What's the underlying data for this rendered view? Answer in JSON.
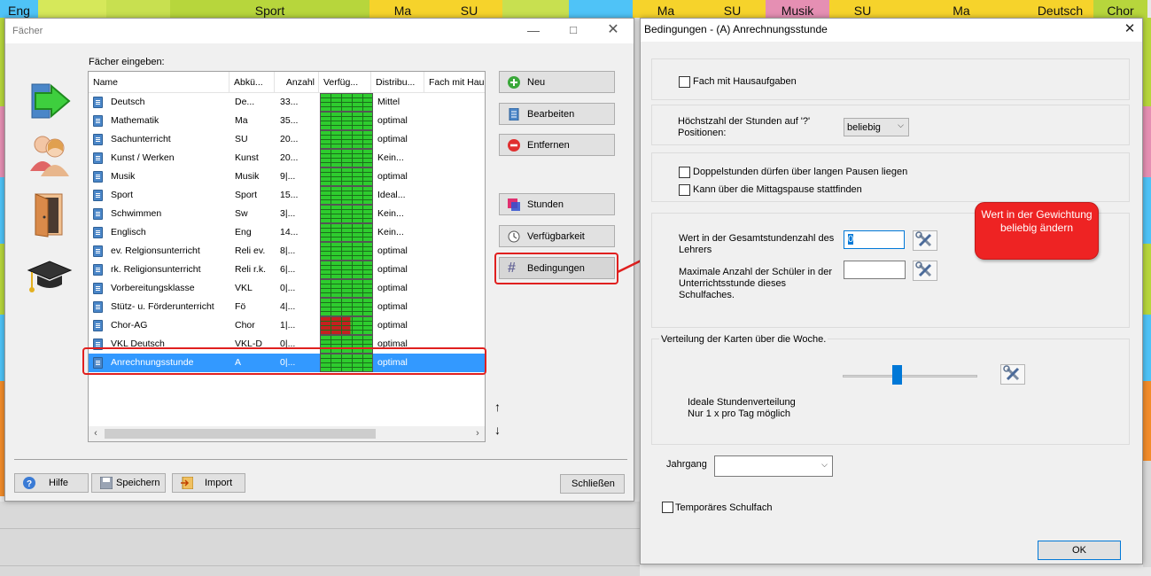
{
  "background": {
    "top_cells": [
      {
        "label": "Eng",
        "color": "#4fc3f7"
      },
      {
        "label": "",
        "color": "#d6e85a"
      },
      {
        "label": "",
        "color": "#c8e050"
      },
      {
        "label": "Sport",
        "color": "#b7d63c"
      },
      {
        "label": "Ma",
        "color": "#f6d32b"
      },
      {
        "label": "SU",
        "color": "#f6d32b"
      },
      {
        "label": "",
        "color": "#c8e050"
      },
      {
        "label": "",
        "color": "#4fc3f7"
      },
      {
        "label": "Ma",
        "color": "#f6d32b"
      },
      {
        "label": "SU",
        "color": "#f6d32b"
      },
      {
        "label": "Musik",
        "color": "#e58fb3"
      },
      {
        "label": "SU",
        "color": "#f6d32b"
      },
      {
        "label": "Ma",
        "color": "#f6d32b"
      },
      {
        "label": "Deutsch",
        "color": "#f6d32b"
      },
      {
        "label": "Chor",
        "color": "#b7d63c"
      }
    ]
  },
  "faecher_window": {
    "title": "Fächer",
    "list_label": "Fächer eingeben:",
    "columns": [
      "Name",
      "Abkü...",
      "Anzahl",
      "Verfüg...",
      "Distribu...",
      "Fach mit Hau"
    ],
    "rows": [
      {
        "name": "Deutsch",
        "abk": "De...",
        "anzahl": "33...",
        "dist": "Mittel",
        "grid": "green"
      },
      {
        "name": "Mathematik",
        "abk": "Ma",
        "anzahl": "35...",
        "dist": "optimal",
        "grid": "green"
      },
      {
        "name": "Sachunterricht",
        "abk": "SU",
        "anzahl": "20...",
        "dist": "optimal",
        "grid": "green"
      },
      {
        "name": "Kunst / Werken",
        "abk": "Kunst",
        "anzahl": "20...",
        "dist": "Kein...",
        "grid": "green"
      },
      {
        "name": "Musik",
        "abk": "Musik",
        "anzahl": "9|...",
        "dist": "optimal",
        "grid": "green"
      },
      {
        "name": "Sport",
        "abk": "Sport",
        "anzahl": "15...",
        "dist": "Ideal...",
        "grid": "green"
      },
      {
        "name": "Schwimmen",
        "abk": "Sw",
        "anzahl": "3|...",
        "dist": "Kein...",
        "grid": "green"
      },
      {
        "name": "Englisch",
        "abk": "Eng",
        "anzahl": "14...",
        "dist": "Kein...",
        "grid": "green"
      },
      {
        "name": "ev. Relgionsunterricht",
        "abk": "Reli ev.",
        "anzahl": "8|...",
        "dist": "optimal",
        "grid": "green"
      },
      {
        "name": "rk. Religionsunterricht",
        "abk": "Reli r.k.",
        "anzahl": "6|...",
        "dist": "optimal",
        "grid": "green"
      },
      {
        "name": "Vorbereitungsklasse",
        "abk": "VKL",
        "anzahl": "0|...",
        "dist": "optimal",
        "grid": "green"
      },
      {
        "name": "Stütz- u. Förderunterricht",
        "abk": "Fö",
        "anzahl": "4|...",
        "dist": "optimal",
        "grid": "green"
      },
      {
        "name": "Chor-AG",
        "abk": "Chor",
        "anzahl": "1|...",
        "dist": "optimal",
        "grid": "red"
      },
      {
        "name": "VKL Deutsch",
        "abk": "VKL-D",
        "anzahl": "0|...",
        "dist": "optimal",
        "grid": "green"
      },
      {
        "name": "Anrechnungsstunde",
        "abk": "A",
        "anzahl": "0|...",
        "dist": "optimal",
        "grid": "green",
        "selected": true
      }
    ],
    "buttons": {
      "neu": "Neu",
      "bearbeiten": "Bearbeiten",
      "entfernen": "Entfernen",
      "stunden": "Stunden",
      "verfuegbarkeit": "Verfügbarkeit",
      "bedingungen": "Bedingungen",
      "hilfe": "Hilfe",
      "speichern": "Speichern",
      "import": "Import",
      "schliessen": "Schließen"
    },
    "side_icons": [
      "subject-arrow-icon",
      "teachers-icon",
      "door-icon",
      "graduation-cap-icon"
    ]
  },
  "dialog": {
    "title": "Bedingungen - (A) Anrechnungsstunde",
    "fach_mit_hausaufgaben": "Fach mit Hausaufgaben",
    "hoechstzahl_label": "Höchstzahl der Stunden auf '?' Positionen:",
    "hoechstzahl_value": "beliebig",
    "doppelstunden": "Doppelstunden dürfen über langen Pausen liegen",
    "mittagspause": "Kann über die Mittagspause stattfinden",
    "wert_label": "Wert in der Gesamtstundenzahl des Lehrers",
    "wert_value": "0",
    "max_schueler_label": "Maximale Anzahl der Schüler in der Unterrichtsstunde dieses Schulfaches.",
    "max_schueler_value": "",
    "verteilung_label": "Verteilung der Karten über die Woche.",
    "slider_level_percent": 50,
    "verteilung_desc1": "Ideale Stundenverteilung",
    "verteilung_desc2": "Nur 1 x pro Tag möglich",
    "jahrgang_label": "Jahrgang",
    "jahrgang_value": "",
    "temporaeres": "Temporäres Schulfach",
    "ok": "OK"
  },
  "callout": {
    "text": "Wert in der Gewichtung beliebig ändern",
    "color": "#ee2323"
  }
}
